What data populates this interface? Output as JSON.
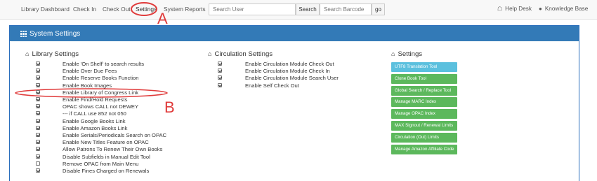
{
  "nav": {
    "links": [
      "Library Dashboard",
      "Check In",
      "Check Out",
      "Settings",
      "System Reports"
    ],
    "search_user_placeholder": "Search User",
    "search_button": "Search",
    "search_barcode_placeholder": "Search Barcode",
    "go_button": "go",
    "help_desk": "Help Desk",
    "knowledge_base": "Knowledge Base"
  },
  "annotations": {
    "a": "A",
    "b": "B"
  },
  "panel": {
    "title": "System Settings"
  },
  "library_settings": {
    "heading": "Library Settings",
    "items": [
      {
        "label": "Enable 'On Shelf' to search results",
        "checked": true
      },
      {
        "label": "Enable Over Due Fees",
        "checked": true
      },
      {
        "label": "Enable Reserve Books Function",
        "checked": true
      },
      {
        "label": "Enable Book Images",
        "checked": true
      },
      {
        "label": "Enable Library of Congress Link",
        "checked": true
      },
      {
        "label": "Enable Find/Hold Requests",
        "checked": true
      },
      {
        "label": "OPAC shows CALL not DEWEY",
        "checked": true
      },
      {
        "label": "--- if CALL use 852 not 050",
        "checked": true
      },
      {
        "label": "Enable Google Books Link",
        "checked": true
      },
      {
        "label": "Enable Amazon Books Link",
        "checked": true
      },
      {
        "label": "Enable Serials/Periodicals Search on OPAC",
        "checked": true
      },
      {
        "label": "Enable New Titles Feature on OPAC",
        "checked": true
      },
      {
        "label": "Allow Patrons To Renew Their Own Books",
        "checked": true
      },
      {
        "label": "Disable Subfields in Manual Edit Tool",
        "checked": true
      },
      {
        "label": "Remove OPAC from Main Menu",
        "checked": false
      },
      {
        "label": "Disable Fines Charged on Renewals",
        "checked": true
      }
    ]
  },
  "circulation_settings": {
    "heading": "Circulation Settings",
    "items": [
      {
        "label": "Enable Circulation Module Check Out",
        "checked": true
      },
      {
        "label": "Enable Circulation Module Check In",
        "checked": true
      },
      {
        "label": "Enable Circulation Module Search User",
        "checked": true
      },
      {
        "label": "Enable Self Check Out",
        "checked": true
      }
    ]
  },
  "settings": {
    "heading": "Settings",
    "buttons": [
      {
        "label": "UTF8 Translation Tool",
        "color": "#5bc0de"
      },
      {
        "label": "Clone Book Tool",
        "color": "#5cb85c"
      },
      {
        "label": "Global Search / Replace Tool",
        "color": "#5cb85c"
      },
      {
        "label": "Manage MARC Index",
        "color": "#5cb85c"
      },
      {
        "label": "Manage OPAC Index",
        "color": "#5cb85c"
      },
      {
        "label": "MAX Signout / Renewal Limits",
        "color": "#5cb85c"
      },
      {
        "label": "Circulation (Out) Limits",
        "color": "#5cb85c"
      },
      {
        "label": "Manage Amazon Affiliate Code",
        "color": "#5cb85c"
      }
    ]
  },
  "colors": {
    "panel_header": "#337ab7",
    "annotation": "#e03b3b",
    "success": "#5cb85c",
    "info": "#5bc0de"
  }
}
